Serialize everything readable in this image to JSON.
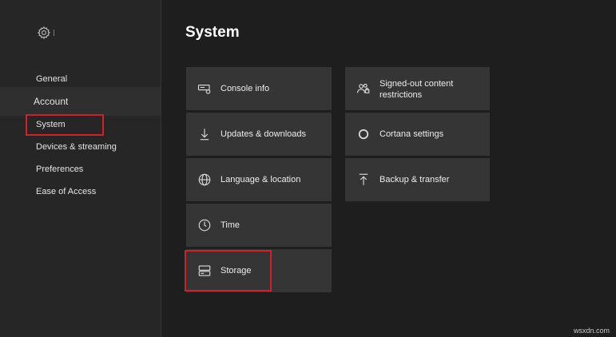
{
  "sidebar": {
    "items": [
      {
        "id": "general",
        "label": "General"
      },
      {
        "id": "account",
        "label": "Account"
      },
      {
        "id": "system",
        "label": "System"
      },
      {
        "id": "devices",
        "label": "Devices & streaming"
      },
      {
        "id": "preferences",
        "label": "Preferences"
      },
      {
        "id": "ease",
        "label": "Ease of Access"
      }
    ]
  },
  "main": {
    "title": "System",
    "tiles": [
      {
        "id": "console-info",
        "label": "Console info",
        "icon": "console-icon"
      },
      {
        "id": "updates",
        "label": "Updates & downloads",
        "icon": "download-arrow-icon"
      },
      {
        "id": "language",
        "label": "Language & location",
        "icon": "globe-icon"
      },
      {
        "id": "time",
        "label": "Time",
        "icon": "clock-icon"
      },
      {
        "id": "storage",
        "label": "Storage",
        "icon": "storage-icon"
      },
      {
        "id": "signed-out",
        "label_line1": "Signed-out content",
        "label_line2": "restrictions",
        "icon": "users-lock-icon"
      },
      {
        "id": "cortana",
        "label": "Cortana settings",
        "icon": "circle-icon"
      },
      {
        "id": "backup",
        "label": "Backup & transfer",
        "icon": "upload-arrow-icon"
      }
    ]
  },
  "colors": {
    "highlight": "#d0202a",
    "tile": "#353535",
    "sidebar": "#262626",
    "background": "#1e1e1e"
  },
  "watermark": "wsxdn.com"
}
